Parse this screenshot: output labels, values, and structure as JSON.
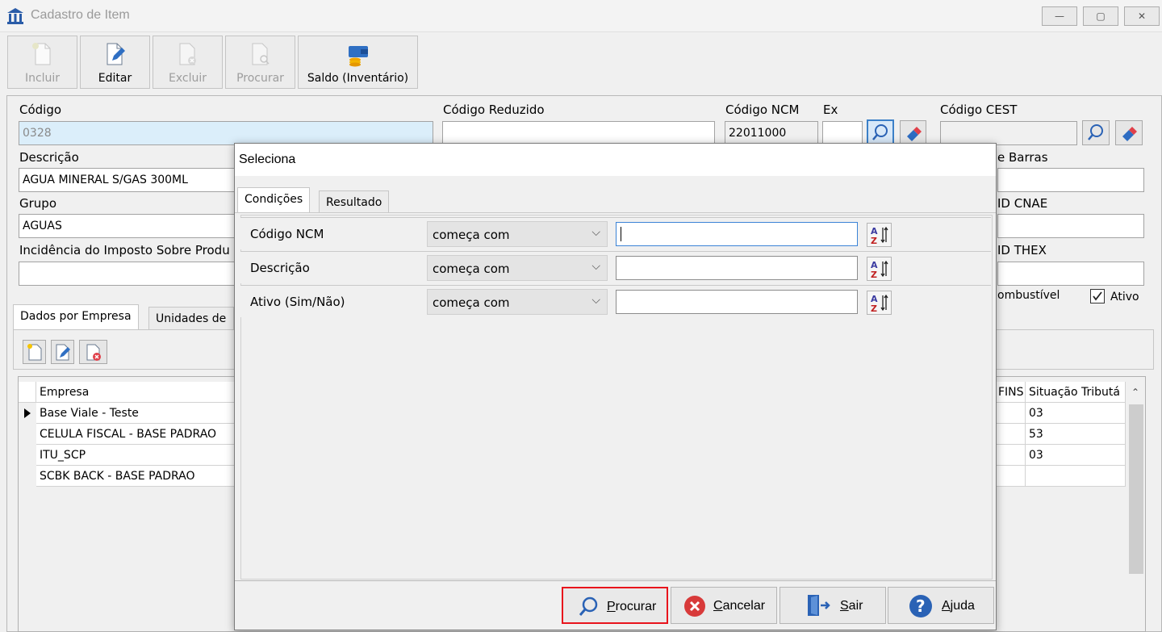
{
  "window": {
    "title": "Cadastro de Item",
    "controls": {
      "minimize": "—",
      "restore": "▢",
      "close": "✕"
    }
  },
  "toolbar": {
    "incluir": "Incluir",
    "editar": "Editar",
    "excluir": "Excluir",
    "procurar": "Procurar",
    "saldo": "Saldo (Inventário)"
  },
  "form": {
    "codigo_label": "Código",
    "codigo_value": "0328",
    "codigo_reduzido_label": "Código Reduzido",
    "codigo_reduzido_value": "",
    "codigo_ncm_label": "Código NCM",
    "codigo_ncm_value": "22011000",
    "ex_label": "Ex",
    "ex_value": "",
    "codigo_cest_label": "Código CEST",
    "codigo_cest_value": "",
    "descricao_label": "Descrição",
    "descricao_value": "AGUA MINERAL S/GAS 300ML",
    "barras_label": "e Barras",
    "grupo_label": "Grupo",
    "grupo_value": "AGUAS",
    "cnae_label": "ID CNAE",
    "incidencia_label": "Incidência do Imposto Sobre Produ",
    "thex_label": "ID THEX",
    "combustivel_label": "ombustível",
    "ativo_label": "Ativo",
    "ativo_checked": true
  },
  "tabs": {
    "dados_empresa": "Dados por Empresa",
    "unidades": "Unidades de"
  },
  "grid": {
    "headers": {
      "empresa": "Empresa",
      "cofins": "FINS",
      "situacao": "Situação Tributá"
    },
    "rows": [
      {
        "empresa": "Base Viale - Teste",
        "situacao": "03",
        "current": true
      },
      {
        "empresa": "CELULA FISCAL - BASE PADRAO",
        "situacao": "53",
        "current": false
      },
      {
        "empresa": "ITU_SCP",
        "situacao": "03",
        "current": false
      },
      {
        "empresa": "SCBK BACK - BASE PADRAO",
        "situacao": "",
        "current": false
      }
    ]
  },
  "dialog": {
    "title": "Seleciona",
    "tab_condicoes": "Condições",
    "tab_resultado": "Resultado",
    "conditions": [
      {
        "field": "Código NCM",
        "operator": "começa com",
        "value": ""
      },
      {
        "field": "Descrição",
        "operator": "começa com",
        "value": ""
      },
      {
        "field": "Ativo (Sim/Não)",
        "operator": "começa com",
        "value": ""
      }
    ],
    "buttons": {
      "procurar_pre": "P",
      "procurar_post": "rocurar",
      "cancelar_pre": "C",
      "cancelar_post": "ancelar",
      "sair_pre": "S",
      "sair_post": "air",
      "ajuda_pre": "A",
      "ajuda_post": "juda"
    }
  },
  "colors": {
    "highlight": "#e8141c",
    "field_blue": "#dbeefa",
    "accent": "#3b83d6"
  }
}
